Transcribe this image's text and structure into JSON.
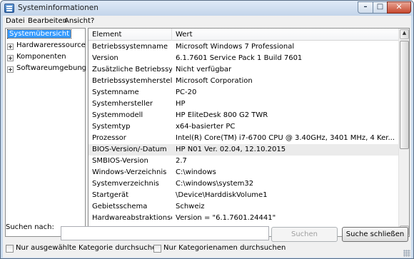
{
  "window": {
    "title": "Systeminformationen",
    "controls": {
      "minimize": "–",
      "maximize": "□",
      "close": "✕"
    }
  },
  "menu": [
    "Datei",
    "Bearbeiten",
    "Ansicht",
    "?"
  ],
  "tree": {
    "items": [
      {
        "label": "Systemübersicht",
        "selected": true,
        "expandable": false
      },
      {
        "label": "Hardwareressourcen",
        "selected": false,
        "expandable": true
      },
      {
        "label": "Komponenten",
        "selected": false,
        "expandable": true
      },
      {
        "label": "Softwareumgebung",
        "selected": false,
        "expandable": true
      }
    ]
  },
  "list": {
    "columns": [
      "Element",
      "Wert"
    ],
    "rows": [
      {
        "name": "Betriebssystemname",
        "value": "Microsoft Windows 7 Professional"
      },
      {
        "name": "Version",
        "value": "6.1.7601 Service Pack 1 Build 7601"
      },
      {
        "name": "Zusätzliche Betriebssyst...",
        "value": "Nicht verfügbar"
      },
      {
        "name": "Betriebssystemhersteller",
        "value": "Microsoft Corporation"
      },
      {
        "name": "Systemname",
        "value": "PC-20"
      },
      {
        "name": "Systemhersteller",
        "value": "HP"
      },
      {
        "name": "Systemmodell",
        "value": "HP EliteDesk 800 G2 TWR"
      },
      {
        "name": "Systemtyp",
        "value": "x64-basierter PC"
      },
      {
        "name": "Prozessor",
        "value": "Intel(R) Core(TM) i7-6700 CPU @ 3.40GHz, 3401 MHz, 4 Ker..."
      },
      {
        "name": "BIOS-Version/-Datum",
        "value": "HP N01 Ver. 02.04, 12.10.2015"
      },
      {
        "name": "SMBIOS-Version",
        "value": "2.7"
      },
      {
        "name": "Windows-Verzeichnis",
        "value": "C:\\windows"
      },
      {
        "name": "Systemverzeichnis",
        "value": "C:\\windows\\system32"
      },
      {
        "name": "Startgerät",
        "value": "\\Device\\HarddiskVolume1"
      },
      {
        "name": "Gebietsschema",
        "value": "Schweiz"
      },
      {
        "name": "Hardwareabstraktionse...",
        "value": "Version = \"6.1.7601.24441\""
      }
    ],
    "highlighted_row": 9
  },
  "search": {
    "label": "Suchen nach:",
    "value": "",
    "search_button": "Suchen",
    "close_button": "Suche schließen",
    "checkbox_selected_category": "Nur ausgewählte Kategorie durchsuchen",
    "checkbox_category_names": "Nur Kategorienamen durchsuchen"
  },
  "colors": {
    "selection": "#3399ff",
    "frame": "#c9dbef",
    "close_button": "#c7492f"
  }
}
